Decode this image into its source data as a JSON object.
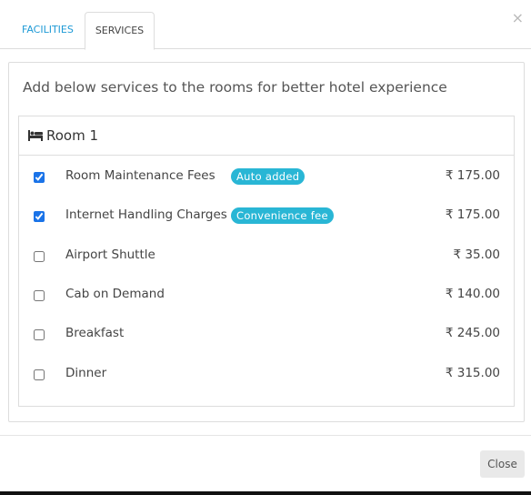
{
  "tabs": [
    {
      "label": "FACILITIES",
      "active": false
    },
    {
      "label": "SERVICES",
      "active": true
    }
  ],
  "close_x": "×",
  "intro_text": "Add below services to the rooms for better hotel experience",
  "room": {
    "icon": "bed-icon",
    "title": "Room 1",
    "services": [
      {
        "name": "Room Maintenance Fees",
        "badge": "Auto added",
        "price": "₹ 175.00",
        "checked": true
      },
      {
        "name": "Internet Handling Charges",
        "badge": "Convenience fee",
        "price": "₹ 175.00",
        "checked": true
      },
      {
        "name": "Airport Shuttle",
        "badge": "",
        "price": "₹ 35.00",
        "checked": false
      },
      {
        "name": "Cab on Demand",
        "badge": "",
        "price": "₹ 140.00",
        "checked": false
      },
      {
        "name": "Breakfast",
        "badge": "",
        "price": "₹ 245.00",
        "checked": false
      },
      {
        "name": "Dinner",
        "badge": "",
        "price": "₹ 315.00",
        "checked": false
      }
    ]
  },
  "close_button": "Close",
  "colors": {
    "tab_active_link": "#1e9ad6",
    "badge": "#29b6d5",
    "checkbox": "#1a73e8"
  }
}
